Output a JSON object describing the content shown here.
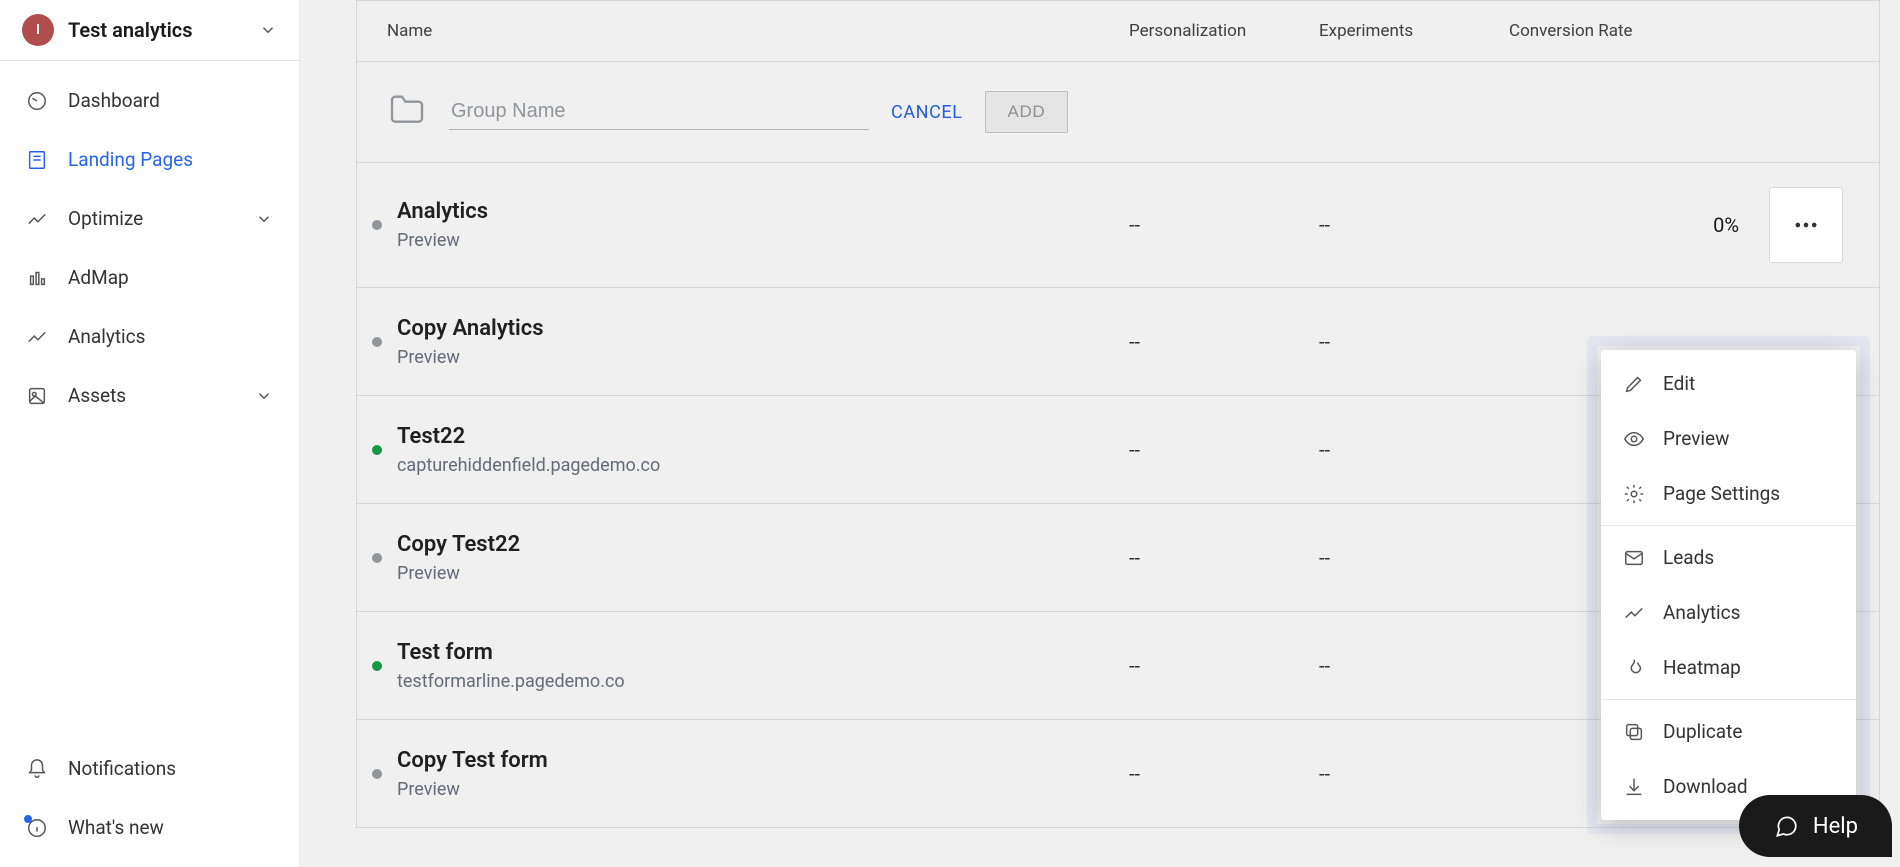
{
  "account": {
    "initial": "I",
    "name": "Test analytics"
  },
  "nav": {
    "items": [
      {
        "label": "Dashboard",
        "icon": "dashboard-icon"
      },
      {
        "label": "Landing Pages",
        "icon": "landing-pages-icon"
      },
      {
        "label": "Optimize",
        "icon": "optimize-icon"
      },
      {
        "label": "AdMap",
        "icon": "admap-icon"
      },
      {
        "label": "Analytics",
        "icon": "analytics-icon"
      },
      {
        "label": "Assets",
        "icon": "assets-icon"
      }
    ],
    "bottom": [
      {
        "label": "Notifications",
        "icon": "bell-icon"
      },
      {
        "label": "What's new",
        "icon": "info-icon"
      }
    ]
  },
  "table": {
    "columns": {
      "name": "Name",
      "personalization": "Personalization",
      "experiments": "Experiments",
      "conversion": "Conversion Rate"
    },
    "new_group": {
      "placeholder": "Group Name",
      "cancel": "CANCEL",
      "add": "ADD"
    },
    "rows": [
      {
        "title": "Analytics",
        "sub": "Preview",
        "status": "grey",
        "personalization": "--",
        "experiments": "--",
        "conversion": "0%",
        "show_kebab": true
      },
      {
        "title": "Copy Analytics",
        "sub": "Preview",
        "status": "grey",
        "personalization": "--",
        "experiments": "--",
        "conversion": "",
        "show_kebab": false
      },
      {
        "title": "Test22",
        "sub": "capturehiddenfield.pagedemo.co",
        "status": "green",
        "personalization": "--",
        "experiments": "--",
        "conversion": "",
        "show_kebab": false
      },
      {
        "title": "Copy Test22",
        "sub": "Preview",
        "status": "grey",
        "personalization": "--",
        "experiments": "--",
        "conversion": "",
        "show_kebab": false
      },
      {
        "title": "Test form",
        "sub": "testformarline.pagedemo.co",
        "status": "green",
        "personalization": "--",
        "experiments": "--",
        "conversion": "",
        "show_kebab": false
      },
      {
        "title": "Copy Test form",
        "sub": "Preview",
        "status": "grey",
        "personalization": "--",
        "experiments": "--",
        "conversion": "",
        "show_kebab": false
      }
    ]
  },
  "context_menu": {
    "groups": [
      [
        {
          "label": "Edit",
          "icon": "pencil-icon"
        },
        {
          "label": "Preview",
          "icon": "eye-icon"
        },
        {
          "label": "Page Settings",
          "icon": "gear-icon"
        }
      ],
      [
        {
          "label": "Leads",
          "icon": "mail-icon"
        },
        {
          "label": "Analytics",
          "icon": "trend-icon"
        },
        {
          "label": "Heatmap",
          "icon": "flame-icon"
        }
      ],
      [
        {
          "label": "Duplicate",
          "icon": "copy-icon"
        },
        {
          "label": "Download",
          "icon": "download-icon"
        }
      ]
    ]
  },
  "help": {
    "label": "Help"
  }
}
